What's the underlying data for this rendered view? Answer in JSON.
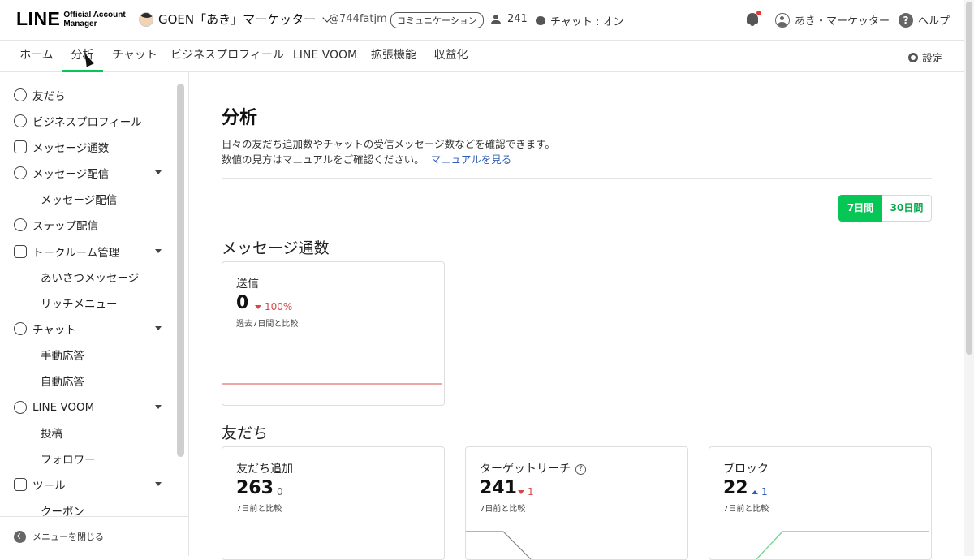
{
  "header": {
    "logo_main": "LINE",
    "logo_sub_line1": "Official Account",
    "logo_sub_line2": "Manager",
    "account_name": "GOEN「あき」マーケッター",
    "account_id": "@744fatjm",
    "category_badge": "コミュニケーション",
    "friend_count": "241",
    "chat_status": "チャット : オン",
    "user_name": "あき・マーケッター",
    "help_label": "ヘルプ",
    "notification_dot_color": "#e53935"
  },
  "nav": {
    "tabs": [
      "ホーム",
      "分析",
      "チャット",
      "ビジネスプロフィール",
      "LINE VOOM",
      "拡張機能",
      "収益化"
    ],
    "active_tab": "分析",
    "settings_label": "設定",
    "accent_color": "#06c755"
  },
  "sidebar": {
    "items": [
      {
        "label": "友だち",
        "icon": "person-add-icon"
      },
      {
        "label": "ビジネスプロフィール",
        "icon": "profile-icon"
      },
      {
        "label": "メッセージ通数",
        "icon": "inbox-icon"
      },
      {
        "label": "メッセージ配信",
        "icon": "broadcast-icon",
        "expandable": true
      },
      {
        "label": "メッセージ配信",
        "sub": true
      },
      {
        "label": "ステップ配信",
        "icon": "step-icon"
      },
      {
        "label": "トークルーム管理",
        "icon": "talkroom-icon",
        "expandable": true
      },
      {
        "label": "あいさつメッセージ",
        "sub": true
      },
      {
        "label": "リッチメニュー",
        "sub": true
      },
      {
        "label": "チャット",
        "icon": "chat-icon",
        "expandable": true
      },
      {
        "label": "手動応答",
        "sub": true
      },
      {
        "label": "自動応答",
        "sub": true
      },
      {
        "label": "LINE VOOM",
        "icon": "voom-icon",
        "expandable": true
      },
      {
        "label": "投稿",
        "sub": true
      },
      {
        "label": "フォロワー",
        "sub": true
      },
      {
        "label": "ツール",
        "icon": "store-icon",
        "expandable": true
      },
      {
        "label": "クーポン",
        "sub": true
      }
    ],
    "close_menu_label": "メニューを閉じる"
  },
  "main": {
    "title": "分析",
    "desc_line1": "日々の友だち追加数やチャットの受信メッセージ数などを確認できます。",
    "desc_line2": "数値の見方はマニュアルをご確認ください。",
    "manual_link": "マニュアルを見る",
    "range_7": "7日間",
    "range_30": "30日間",
    "section_messages": "メッセージ通数",
    "section_friends": "友だち",
    "cards": {
      "sent": {
        "label": "送信",
        "value": "0",
        "diff": "100%",
        "diff_dir": "down",
        "note": "過去7日間と比較"
      },
      "friend_add": {
        "label": "友だち追加",
        "value": "263",
        "diff": "0",
        "diff_dir": "flat",
        "note": "7日前と比較"
      },
      "target_reach": {
        "label": "ターゲットリーチ",
        "value": "241",
        "diff": "1",
        "diff_dir": "down",
        "note": "7日前と比較"
      },
      "block": {
        "label": "ブロック",
        "value": "22",
        "diff": "1",
        "diff_dir": "up",
        "note": "7日前と比較"
      }
    },
    "help_glyph": "?"
  }
}
